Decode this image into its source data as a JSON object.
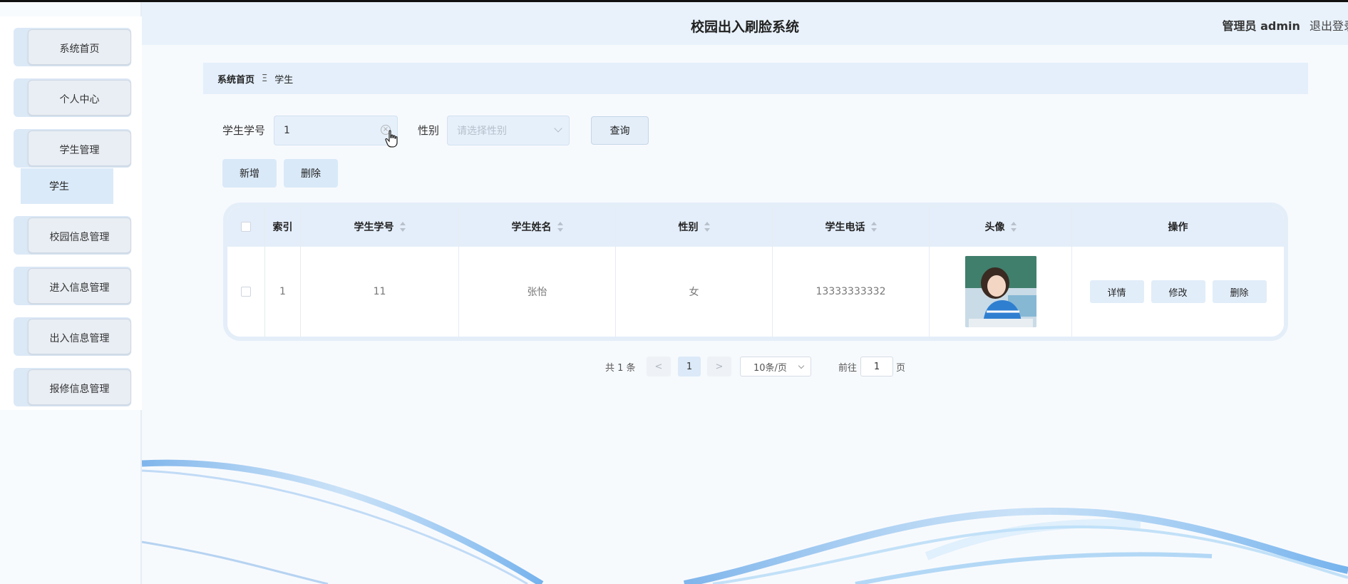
{
  "header": {
    "title": "校园出入刷脸系统",
    "user_role": "管理员 admin",
    "logout": "退出登录"
  },
  "sidebar": {
    "items": [
      {
        "label": "系统首页"
      },
      {
        "label": "个人中心"
      },
      {
        "label": "学生管理"
      },
      {
        "label": "校园信息管理"
      },
      {
        "label": "进入信息管理"
      },
      {
        "label": "出入信息管理"
      },
      {
        "label": "报修信息管理"
      }
    ],
    "sub_items": [
      {
        "label": "学生"
      }
    ]
  },
  "breadcrumb": {
    "home": "系统首页",
    "separator": "Ξ",
    "current": "学生"
  },
  "search": {
    "student_no_label": "学生学号",
    "student_no_value": "1",
    "gender_label": "性别",
    "gender_placeholder": "请选择性别",
    "query_button": "查询"
  },
  "actions": {
    "add": "新增",
    "delete": "删除"
  },
  "table": {
    "columns": [
      "索引",
      "学生学号",
      "学生姓名",
      "性别",
      "学生电话",
      "头像",
      "操作"
    ],
    "rows": [
      {
        "index": "1",
        "student_no": "11",
        "name": "张怡",
        "gender": "女",
        "phone": "13333333332",
        "avatar": "student-photo",
        "ops": [
          "详情",
          "修改",
          "删除"
        ]
      }
    ]
  },
  "pagination": {
    "total": "共 1 条",
    "prev": "<",
    "current_page": "1",
    "next": ">",
    "page_size": "10条/页",
    "goto_label": "前往",
    "goto_value": "1",
    "page_suffix": "页"
  },
  "colors": {
    "accent": "#dbe9f8",
    "header_bg": "#e9f2fb"
  }
}
